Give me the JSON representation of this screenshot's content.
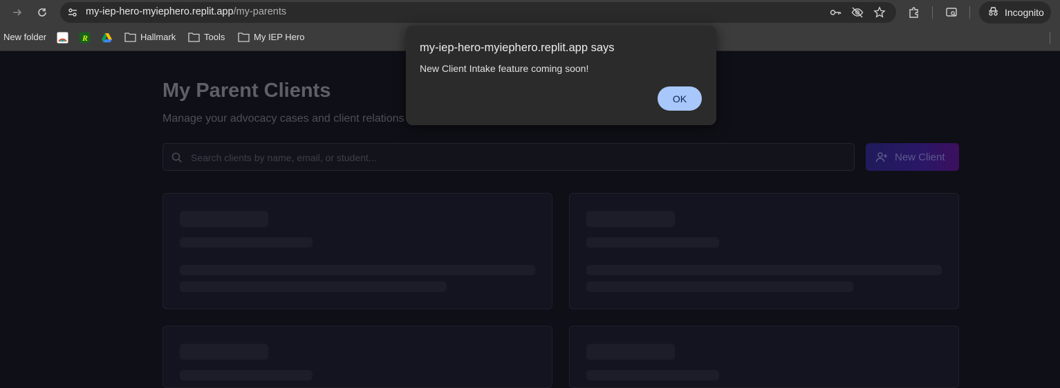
{
  "browser": {
    "url_host": "my-iep-hero-myiephero.replit.app",
    "url_path": "/my-parents",
    "incognito_label": "Incognito",
    "icons": [
      "forward-icon",
      "reload-icon",
      "site-info-icon",
      "key-icon",
      "eye-off-icon",
      "star-icon",
      "extensions-icon",
      "reading-list-icon",
      "incognito-icon"
    ]
  },
  "bookmarks": {
    "items": [
      {
        "label": "New folder"
      },
      {
        "label": "Hallmark"
      },
      {
        "label": "Tools"
      },
      {
        "label": "My IEP Hero"
      }
    ]
  },
  "page": {
    "title": "My Parent Clients",
    "subtitle": "Manage your advocacy cases and client relations",
    "search_placeholder": "Search clients by name, email, or student...",
    "new_client_label": "New Client"
  },
  "dialog": {
    "title": "my-iep-hero-myiephero.replit.app says",
    "message": "New Client Intake feature coming soon!",
    "ok_label": "OK"
  },
  "colors": {
    "page_bg": "#0f0f17",
    "chrome_bg": "#3c3c3c",
    "ok_button": "#a8c7fa",
    "gradient_start": "#1f1b5a",
    "gradient_end": "#3c0f5e"
  }
}
